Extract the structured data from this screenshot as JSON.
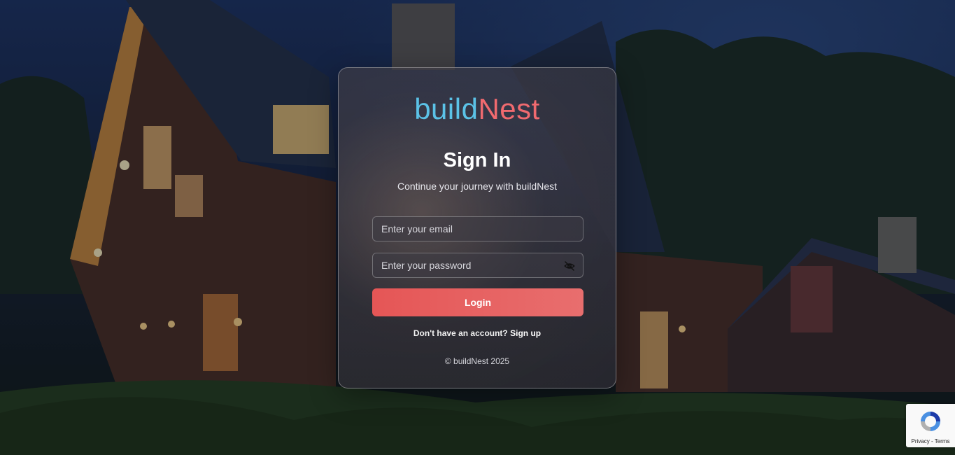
{
  "brand": {
    "part1": "build",
    "part2": "Nest",
    "color1": "#5bc2e7",
    "color2": "#f06a6f"
  },
  "login": {
    "title": "Sign In",
    "subtitle": "Continue your journey with buildNest",
    "email_placeholder": "Enter your email",
    "email_value": "",
    "password_placeholder": "Enter your password",
    "password_value": "",
    "password_toggle_icon": "eye-off-icon",
    "button_label": "Login",
    "button_color": "#e55656",
    "signup_prompt": "Don't have an account?",
    "signup_link": "Sign up",
    "footer": "© buildNest 2025"
  },
  "recaptcha": {
    "privacy": "Privacy",
    "separator": " - ",
    "terms": "Terms",
    "icon": "recaptcha-icon"
  }
}
